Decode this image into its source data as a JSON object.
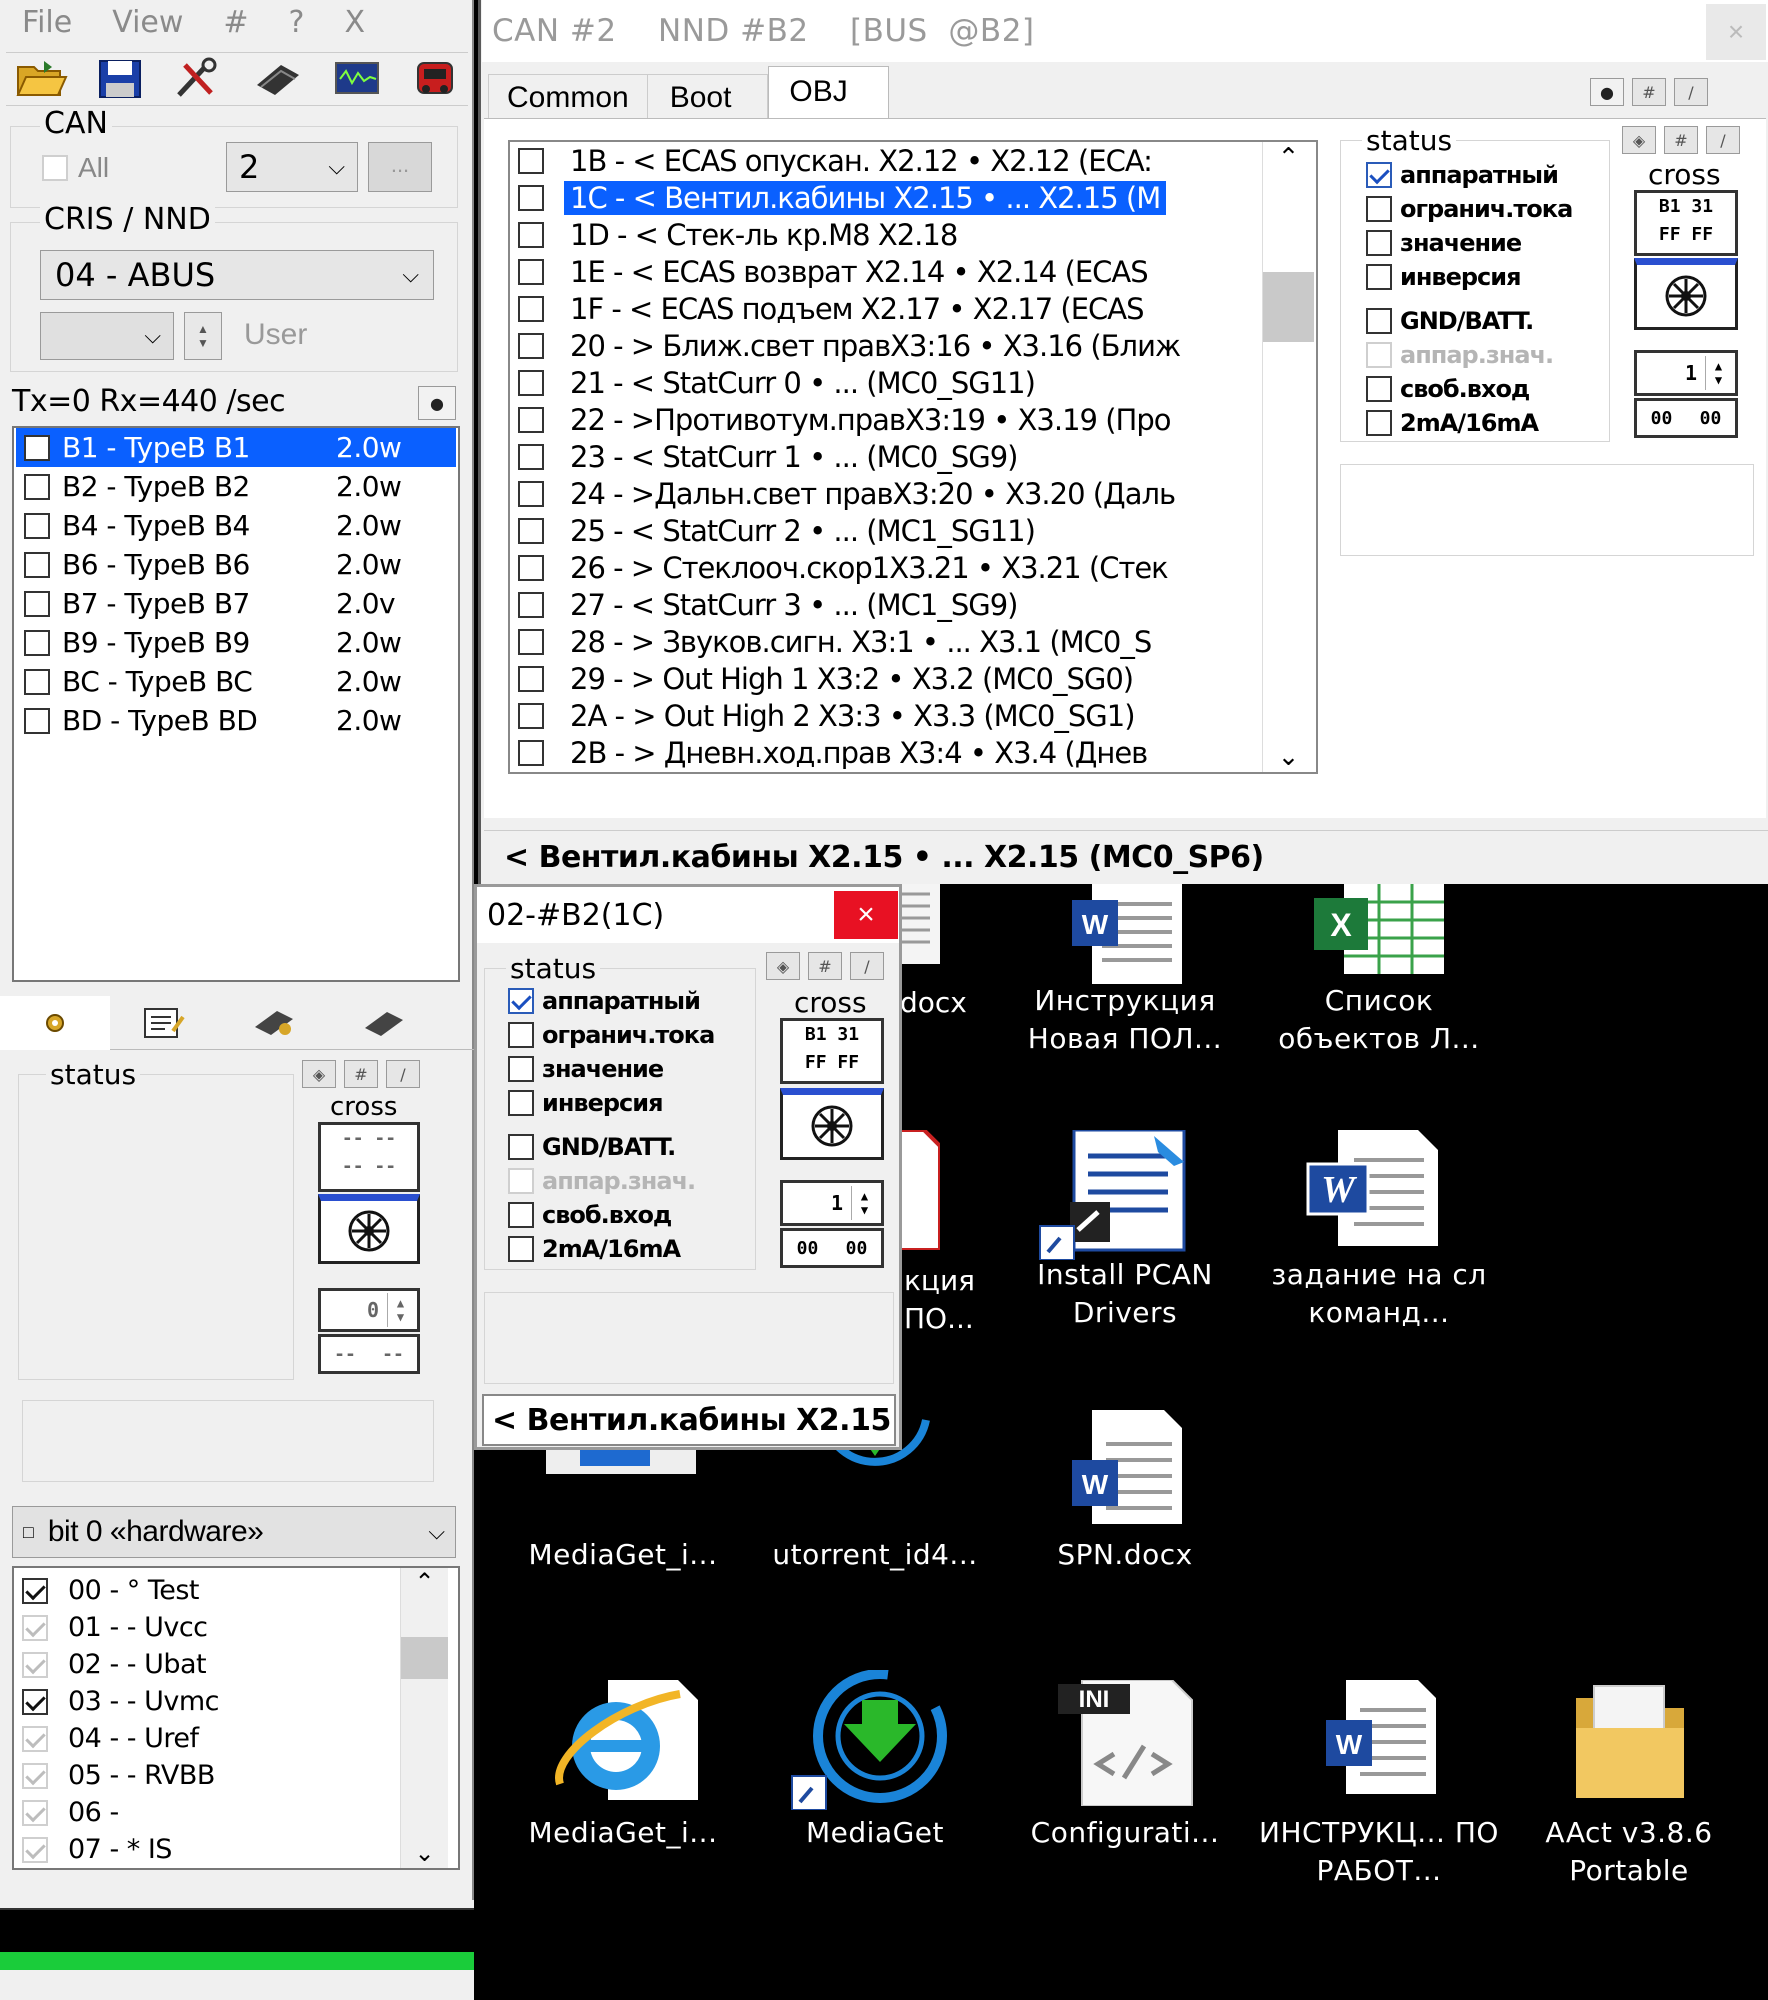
{
  "left_panel": {
    "menu": [
      "File",
      "View",
      "#",
      "?",
      "X"
    ],
    "can_label": "CAN",
    "all_label": "All",
    "can_value": "2",
    "ellipsis": "...",
    "cris_label": "CRIS / NND",
    "cris_value": "04 - ABUS",
    "user_label": "User",
    "rate": "Tx=0 Rx=440 /sec",
    "devices": [
      {
        "name": "B1 - TypeB B1",
        "ver": "2.0w",
        "selected": true
      },
      {
        "name": "B2 - TypeB B2",
        "ver": "2.0w"
      },
      {
        "name": "B4 - TypeB B4",
        "ver": "2.0w"
      },
      {
        "name": "B6 - TypeB B6",
        "ver": "2.0w"
      },
      {
        "name": "B7 - TypeB B7",
        "ver": "2.0v"
      },
      {
        "name": "B9 - TypeB B9",
        "ver": "2.0w"
      },
      {
        "name": "BC - TypeB BC",
        "ver": "2.0w"
      },
      {
        "name": "BD - TypeB BD",
        "ver": "2.0w"
      }
    ],
    "status_label": "status",
    "cross_label": "cross",
    "cross_value": [
      "-- --",
      "-- --"
    ],
    "spin_value": "0",
    "hex_value": [
      "--",
      "--"
    ],
    "bit_select": "bit 0 «hardware»",
    "bits": [
      {
        "text": "00 - ° Test",
        "state": "on"
      },
      {
        "text": "01 - - Uvcc",
        "state": "faint"
      },
      {
        "text": "02 - - Ubat",
        "state": "faint"
      },
      {
        "text": "03 - - Uvmc",
        "state": "on"
      },
      {
        "text": "04 - - Uref",
        "state": "faint"
      },
      {
        "text": "05 - - RVBB",
        "state": "faint"
      },
      {
        "text": "06 -",
        "state": "faint"
      },
      {
        "text": "07 - * IS",
        "state": "faint"
      }
    ]
  },
  "main_window": {
    "title": "CAN #2    NND #B2    [BUS  @B2]",
    "close": "×",
    "tabs": [
      "Common",
      "Boot",
      "OBJ"
    ],
    "active_tab": "OBJ",
    "objects": [
      "1B - < ECAS опускан. X2.12 • X2.12 (ECA:",
      "1C - < Вентил.кабины X2.15 • ... X2.15 (M",
      "1D - < Стек-ль кр.M8 X2.18",
      "1E - < ECAS возврат X2.14 • X2.14 (ECAS",
      "1F - < ECAS подъем  X2.17 • X2.17 (ECAS",
      "20 - > Ближ.свет правX3:16 • X3.16 (Ближ",
      "21 - < StatCurr 0 • ... (MC0_SG11)",
      "22 - >Противотум.правX3:19 • X3.19 (Про",
      "23 - < StatCurr 1 • ... (MC0_SG9)",
      "24 - >Дальн.свет правX3:20 • X3.20 (Даль",
      "25 - < StatCurr 2 • ... (MC1_SG11)",
      "26 - > Стеклооч.скор1X3.21 • X3.21 (Стек",
      "27 - < StatCurr 3 • ... (MC1_SG9)",
      "28 - > Звуков.сигн. X3:1 • ... X3.1 (MC0_S",
      "29 - > Out High 1 X3:2 • X3.2 (MC0_SG0)",
      "2A - > Out High 2 X3:3 • X3.3 (MC0_SG1)",
      "2B - > Дневн.ход.прав X3:4 • X3.4 (Днев"
    ],
    "selected_index": 1,
    "status_label": "status",
    "status_items": [
      {
        "label": "аппаратный",
        "checked": true
      },
      {
        "label": "огранич.тока",
        "checked": false
      },
      {
        "label": "значение",
        "checked": false
      },
      {
        "label": "инверсия",
        "checked": false
      },
      {
        "label": "GND/BATT.",
        "checked": false
      },
      {
        "label": "аппар.знач.",
        "checked": false,
        "faint": true
      },
      {
        "label": "своб.вход",
        "checked": false
      },
      {
        "label": "2mA/16mA",
        "checked": false
      }
    ],
    "cross_label": "cross",
    "cross_value": [
      "B1  31",
      "FF  FF"
    ],
    "spin_value": "1",
    "hex_value": [
      "00",
      "00"
    ],
    "status_bar": "< Вентил.кабины X2.15 • ... X2.15 (MC0_SP6)"
  },
  "popup": {
    "title": "02-#B2(1C)",
    "close": "×",
    "status_label": "status",
    "status_items": [
      {
        "label": "аппаратный",
        "checked": true
      },
      {
        "label": "огранич.тока",
        "checked": false
      },
      {
        "label": "значение",
        "checked": false
      },
      {
        "label": "инверсия",
        "checked": false
      },
      {
        "label": "GND/BATT.",
        "checked": false
      },
      {
        "label": "аппар.знач.",
        "checked": false,
        "faint": true
      },
      {
        "label": "своб.вход",
        "checked": false
      },
      {
        "label": "2mA/16mA",
        "checked": false
      }
    ],
    "cross_label": "cross",
    "cross_value": [
      "B1  31",
      "FF  FF"
    ],
    "spin_value": "1",
    "hex_value": [
      "00",
      "00"
    ],
    "status_bar": "< Вентил.кабины X2.15"
  },
  "desktop": {
    "partial_labels": [
      "docx",
      "кция",
      "ПО..."
    ],
    "icons": [
      {
        "label": "Инструкция Новая ПОЛ...",
        "type": "word"
      },
      {
        "label": "Список объектов Л...",
        "type": "excel"
      },
      {
        "label": "Install PCAN Drivers",
        "type": "installer"
      },
      {
        "label": "задание на сл команд...",
        "type": "word-old"
      },
      {
        "label": "MediaGet_i...",
        "type": "mediaget-installer"
      },
      {
        "label": "utorrent_id4...",
        "type": "download"
      },
      {
        "label": "SPN.docx",
        "type": "word"
      },
      {
        "label": "MediaGet_i...",
        "type": "ie"
      },
      {
        "label": "MediaGet",
        "type": "mediaget"
      },
      {
        "label": "Configurati...",
        "type": "ini"
      },
      {
        "label": "ИНСТРУКЦ... ПО РАБОТ...",
        "type": "word"
      },
      {
        "label": "AAct v3.8.6 Portable",
        "type": "folder"
      }
    ]
  }
}
